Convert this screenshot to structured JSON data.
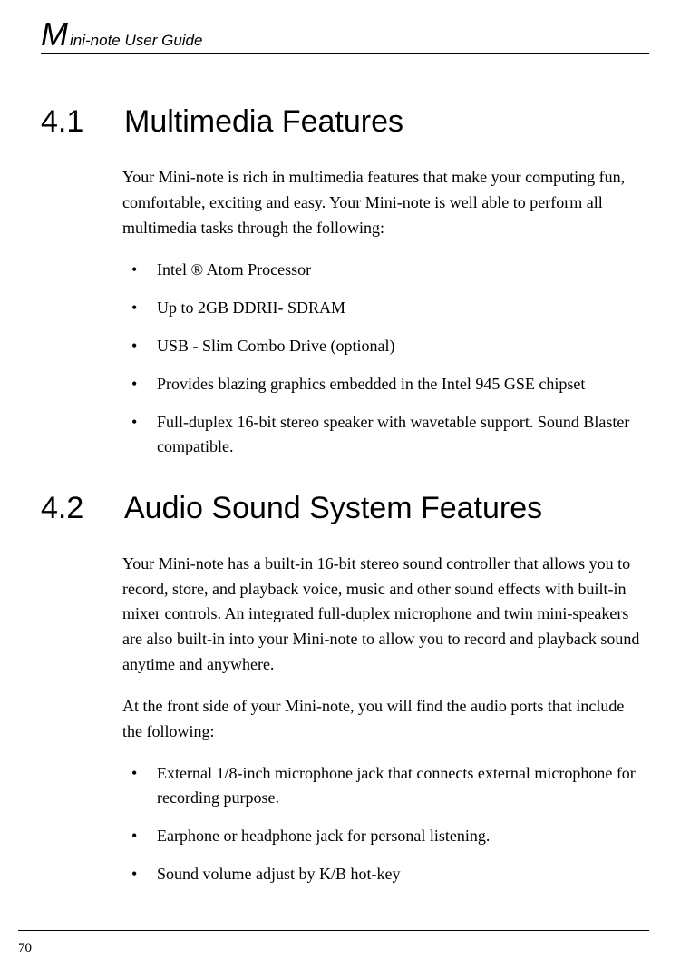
{
  "header": {
    "initial": "M",
    "rest": "ini-note User Guide"
  },
  "sections": {
    "s1": {
      "num": "4.1",
      "title": "Multimedia Features",
      "para1": "Your Mini-note is rich in multimedia features that make your computing fun, comfortable, exciting and easy. Your Mini-note is well able to perform all multimedia tasks through the following:",
      "bullets": {
        "b1": "Intel ® Atom Processor",
        "b2": "Up to 2GB DDRII- SDRAM",
        "b3": "USB - Slim Combo Drive (optional)",
        "b4": "Provides blazing graphics embedded in the Intel 945 GSE chipset",
        "b5": "Full-duplex 16-bit stereo speaker with wavetable support. Sound Blaster compatible."
      }
    },
    "s2": {
      "num": "4.2",
      "title": "Audio Sound System Features",
      "para1": "Your Mini-note has a built-in 16-bit stereo sound controller that allows you to record, store, and playback voice, music and other sound effects with built-in mixer controls. An integrated full-duplex microphone and twin mini-speakers are also built-in into your Mini-note to allow you to record and playback sound anytime and anywhere.",
      "para2": "At the front side of your Mini-note, you will find the audio ports that include the following:",
      "bullets": {
        "b1": "External 1/8-inch microphone jack that connects external microphone for recording purpose.",
        "b2": "Earphone or headphone jack for personal listening.",
        "b3": "Sound volume adjust by K/B hot-key"
      }
    }
  },
  "footer": {
    "page_num": "70"
  }
}
